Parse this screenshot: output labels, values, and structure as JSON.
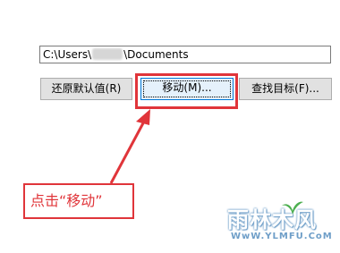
{
  "path_field": {
    "prefix": "C:\\Users\\",
    "suffix": "\\Documents"
  },
  "buttons": {
    "restore_label": "还原默认值(R)",
    "move_label": "移动(M)...",
    "find_label": "查找目标(F)..."
  },
  "annotation": {
    "callout_text": "点击“移动”",
    "color": "#e0353a"
  },
  "watermark": {
    "logo_text": "雨林木风",
    "url": "WwW.YLMFU.CoM"
  }
}
